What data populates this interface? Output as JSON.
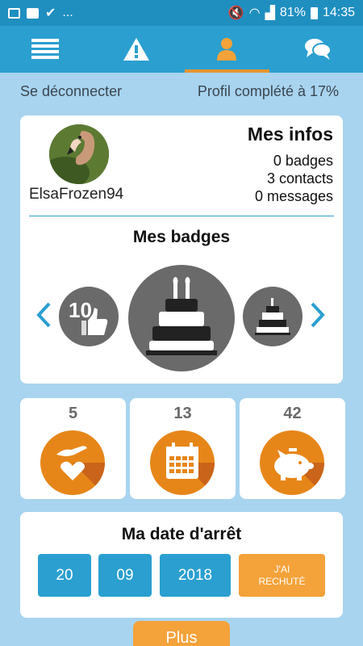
{
  "statusbar": {
    "battery": "81%",
    "time": "14:35",
    "more": "..."
  },
  "nav": {
    "tabs": [
      {
        "icon": "list-icon",
        "active": false
      },
      {
        "icon": "warning-icon",
        "active": false
      },
      {
        "icon": "user-icon",
        "active": true
      },
      {
        "icon": "chat-icon",
        "active": false
      }
    ]
  },
  "header": {
    "logout": "Se déconnecter",
    "profile_progress": "Profil complété à 17%"
  },
  "profile": {
    "username": "ElsaFrozen94",
    "title": "Mes infos",
    "badges_count": "0 badges",
    "contacts_count": "3 contacts",
    "messages_count": "0 messages"
  },
  "badges": {
    "title": "Mes badges",
    "left_badge_number": "10",
    "items": [
      "thumbs-up-10-badge-icon",
      "cake-badge-icon",
      "small-cake-badge-icon"
    ]
  },
  "stats": [
    {
      "value": "5",
      "icon": "hand-heart-icon"
    },
    {
      "value": "13",
      "icon": "calendar-icon"
    },
    {
      "value": "42",
      "icon": "piggy-bank-icon"
    }
  ],
  "quit_date": {
    "title": "Ma date d'arrêt",
    "day": "20",
    "month": "09",
    "year": "2018",
    "relapse_line1": "J'AI",
    "relapse_line2": "RECHUTÉ"
  },
  "more_button": "Plus",
  "colors": {
    "blue": "#2a9fd0",
    "orange": "#f4a23a",
    "badge_gray": "#6a6a6a",
    "background": "#a8d4ef"
  }
}
